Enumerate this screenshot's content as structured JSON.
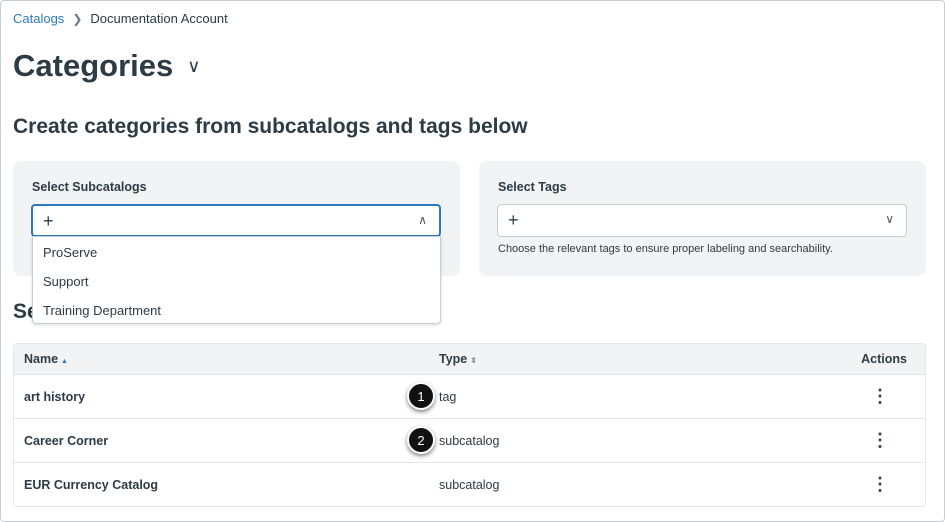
{
  "breadcrumb": {
    "root": "Catalogs",
    "current": "Documentation Account"
  },
  "page_title": "Categories",
  "section_title": "Create categories from subcatalogs and tags below",
  "subcatalogs": {
    "label": "Select Subcatalogs",
    "add": "+",
    "options": [
      "ProServe",
      "Support",
      "Training Department"
    ]
  },
  "tags": {
    "label": "Select Tags",
    "add": "+",
    "hint": "Choose the relevant tags to ensure proper labeling and searchability."
  },
  "selected_heading": "Se",
  "table": {
    "headers": {
      "name": "Name",
      "type": "Type",
      "actions": "Actions"
    },
    "rows": [
      {
        "name": "art history",
        "type": "tag"
      },
      {
        "name": "Career Corner",
        "type": "subcatalog"
      },
      {
        "name": "EUR Currency Catalog",
        "type": "subcatalog"
      }
    ]
  },
  "callouts": [
    "1",
    "2"
  ]
}
